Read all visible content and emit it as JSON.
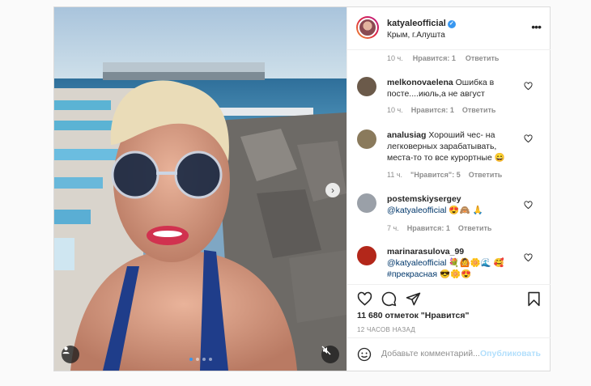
{
  "post": {
    "author": {
      "username": "katyaleofficial",
      "verified": true,
      "location": "Крым, г.Алушта"
    },
    "more_icon": "more-horizontal-icon",
    "media": {
      "carousel_count": 4,
      "active_index": 0,
      "user_tag_icon": "user-icon",
      "mute_icon": "speaker-muted-icon",
      "next_icon": "chevron-right-icon"
    },
    "top_partial_comment": {
      "time": "10 ч.",
      "likes": "Нравится: 1",
      "reply": "Ответить"
    },
    "comments": [
      {
        "username": "melkonovaelena",
        "text": "Ошибка в посте....июль,а не август",
        "time": "10 ч.",
        "likes": "Нравится: 1",
        "reply": "Ответить",
        "avatar_color": "#6b5a4a"
      },
      {
        "username": "analusiag",
        "text": "Хороший чес- на легковерных зарабатывать, места-то то все курортные 😄",
        "time": "11 ч.",
        "likes": "\"Нравится\": 5",
        "reply": "Ответить",
        "avatar_color": "#8a7a5c"
      },
      {
        "username": "postemskiysergey",
        "mention": "@katyaleofficial",
        "text": "😍🙈 🙏",
        "time": "7 ч.",
        "likes": "Нравится: 1",
        "reply": "Ответить",
        "avatar_color": "#9aa0a8"
      },
      {
        "username": "marinarasulova_99",
        "mention": "@katyaleofficial",
        "text": "💐🙆🌼🌊 🥰",
        "text2_tag": "#прекрасная",
        "text2": " 😎🌼😍",
        "avatar_color": "#b3271a"
      }
    ],
    "actions": {
      "like_icon": "heart-icon",
      "comment_icon": "comment-icon",
      "share_icon": "paper-plane-icon",
      "save_icon": "bookmark-icon"
    },
    "likes_text": "11 680 отметок \"Нравится\"",
    "time_text": "12 ЧАСОВ НАЗАД",
    "add_comment": {
      "emoji_icon": "smiley-icon",
      "placeholder": "Добавьте комментарий...",
      "publish_label": "Опубликовать"
    }
  },
  "colors": {
    "link": "#00376b",
    "accent": "#3897f0",
    "muted": "#8e8e8e",
    "publish_disabled": "#b2dffc"
  }
}
